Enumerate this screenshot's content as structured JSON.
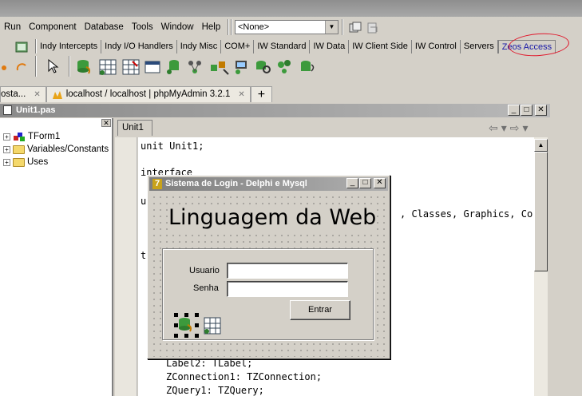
{
  "menu": {
    "items": [
      "Run",
      "Component",
      "Database",
      "Tools",
      "Window",
      "Help"
    ],
    "combo_value": "<None>"
  },
  "palette": {
    "tabs": [
      "Indy Intercepts",
      "Indy I/O Handlers",
      "Indy Misc",
      "COM+",
      "IW Standard",
      "IW Data",
      "IW Client Side",
      "IW Control",
      "Servers",
      "Zeos Access"
    ],
    "active_tab": "Zeos Access",
    "highlight_color": "#e0182c"
  },
  "doc_tabs": {
    "tab1": "osta...",
    "tab2": "localhost / localhost | phpMyAdmin 3.2.1",
    "add": "+"
  },
  "editor_window": {
    "title": "Unit1.pas",
    "tab": "Unit1"
  },
  "tree": {
    "items": [
      "TForm1",
      "Variables/Constants",
      "Uses"
    ]
  },
  "code": {
    "lines": [
      "unit Unit1;",
      "interface",
      "u",
      ", Classes, Graphics, Co",
      "t",
      "Label2: TLabel;",
      "ZConnection1: TZConnection;",
      "ZQuery1: TZQuery;"
    ]
  },
  "form": {
    "title": "Sistema de Login - Delphi e Mysql",
    "heading": "Linguagem da Web",
    "usuario_label": "Usuario",
    "senha_label": "Senha",
    "usuario_value": "",
    "senha_value": "",
    "entrar_button": "Entrar"
  }
}
